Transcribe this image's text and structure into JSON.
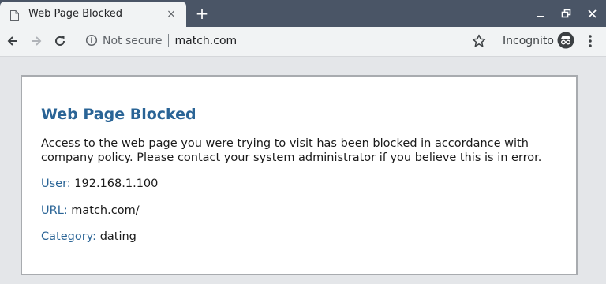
{
  "tab": {
    "title": "Web Page Blocked",
    "close_label": "×",
    "new_tab_label": "+"
  },
  "window_controls": {
    "minimize_icon": "minimize-icon",
    "restore_icon": "restore-icon",
    "close_icon": "close-icon"
  },
  "toolbar": {
    "security_label": "Not secure",
    "url": "match.com",
    "incognito_label": "Incognito"
  },
  "page": {
    "title": "Web Page Blocked",
    "message": "Access to the web page you were trying to visit has been blocked in accordance with company policy. Please contact your system administrator if you believe this is in error.",
    "fields": [
      {
        "label": "User:",
        "value": "192.168.1.100"
      },
      {
        "label": "URL:",
        "value": "match.com/"
      },
      {
        "label": "Category:",
        "value": "dating"
      }
    ]
  },
  "colors": {
    "titlebar": "#4a5566",
    "toolbar": "#f1f3f4",
    "page_background": "#e4e6e9",
    "heading": "#2a6496",
    "card_border": "#a8abaf"
  }
}
